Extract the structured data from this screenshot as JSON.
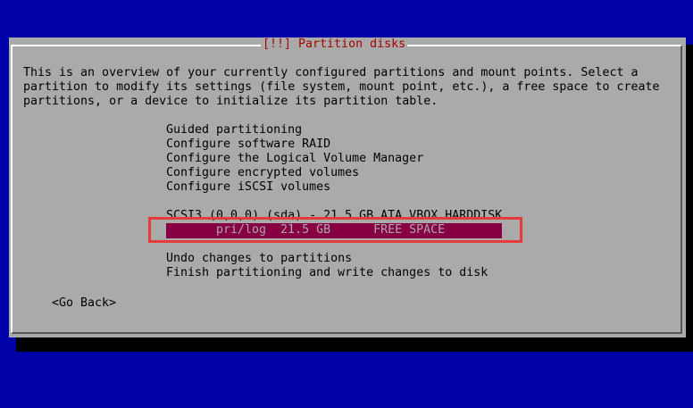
{
  "dialog": {
    "title": "[!!] Partition disks",
    "intro_lines": [
      "This is an overview of your currently configured partitions and mount points. Select a",
      "partition to modify its settings (file system, mount point, etc.), a free space to create",
      "partitions, or a device to initialize its partition table."
    ],
    "menu": [
      "Guided partitioning",
      "Configure software RAID",
      "Configure the Logical Volume Manager",
      "Configure encrypted volumes",
      "Configure iSCSI volumes"
    ],
    "disk": "SCSI3 (0,0,0) (sda) - 21.5 GB ATA VBOX HARDDISK",
    "selected_partition": "pri/log  21.5 GB      FREE SPACE",
    "actions": [
      "Undo changes to partitions",
      "Finish partitioning and write changes to disk"
    ],
    "go_back": "<Go Back>"
  },
  "colors": {
    "background": "#0000a8",
    "dialog": "#aaaaaa",
    "selection": "#880044",
    "title_text": "#a80000",
    "annotation_box": "#e53b3b"
  }
}
